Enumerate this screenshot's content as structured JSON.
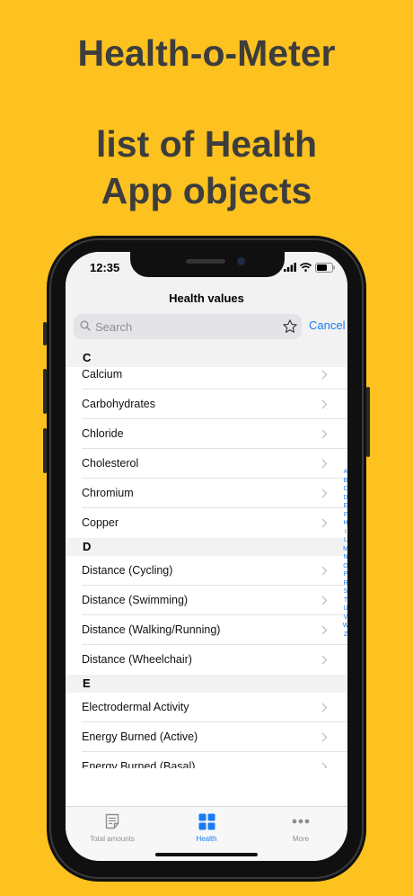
{
  "promo": {
    "line1": "Health-o-Meter",
    "line2": "list of Health",
    "line3": "App objects"
  },
  "statusbar": {
    "time": "12:35"
  },
  "nav": {
    "title": "Health values",
    "search_placeholder": "Search",
    "cancel": "Cancel"
  },
  "sections": [
    {
      "header": "C",
      "items": [
        "Calcium",
        "Carbohydrates",
        "Chloride",
        "Cholesterol",
        "Chromium",
        "Copper"
      ]
    },
    {
      "header": "D",
      "items": [
        "Distance (Cycling)",
        "Distance (Swimming)",
        "Distance (Walking/Running)",
        "Distance (Wheelchair)"
      ]
    },
    {
      "header": "E",
      "items": [
        "Electrodermal Activity",
        "Energy Burned (Active)",
        "Energy Burned (Basal)"
      ]
    }
  ],
  "index_letters": [
    "A",
    "B",
    "C",
    "D",
    "E",
    "F",
    "H",
    "I",
    "L",
    "M",
    "N",
    "O",
    "P",
    "R",
    "S",
    "T",
    "U",
    "V",
    "W",
    "Z"
  ],
  "tabbar": {
    "tabs": [
      {
        "label": "Total amounts",
        "icon": "note-icon",
        "active": false
      },
      {
        "label": "Health",
        "icon": "grid-icon",
        "active": true
      },
      {
        "label": "More",
        "icon": "more-dots-icon",
        "active": false
      }
    ]
  },
  "colors": {
    "background": "#FDC21F",
    "accent": "#1a7cf5",
    "promo_text": "#3d3d3d"
  }
}
